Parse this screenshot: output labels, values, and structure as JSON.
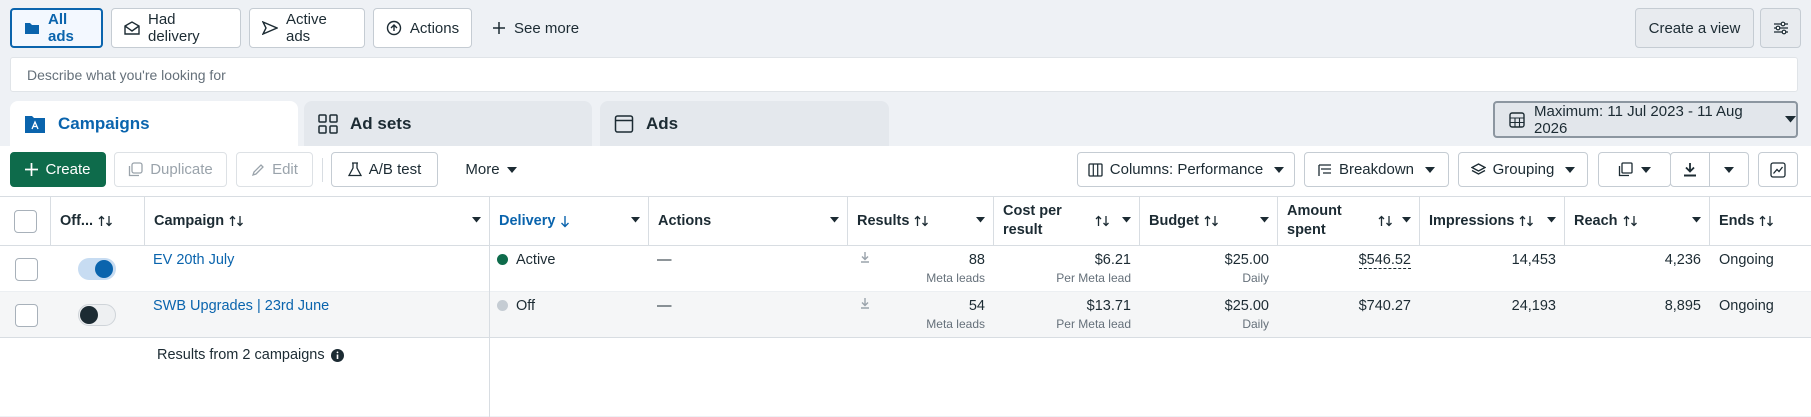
{
  "filters": {
    "all_ads": "All ads",
    "had_delivery": "Had delivery",
    "active_ads": "Active ads",
    "actions": "Actions",
    "see_more": "See more",
    "create_view": "Create a view"
  },
  "search": {
    "placeholder": "Describe what you're looking for"
  },
  "level_tabs": {
    "campaigns": "Campaigns",
    "ad_sets": "Ad sets",
    "ads": "Ads"
  },
  "date_range": "Maximum: 11 Jul 2023 - 11 Aug 2026",
  "toolbar": {
    "create": "Create",
    "duplicate": "Duplicate",
    "edit": "Edit",
    "ab_test": "A/B test",
    "more": "More",
    "columns": "Columns: Performance",
    "breakdown": "Breakdown",
    "grouping": "Grouping"
  },
  "columns": {
    "off_on": "Off...",
    "campaign": "Campaign",
    "delivery": "Delivery",
    "actions": "Actions",
    "results": "Results",
    "cost_per_result": [
      "Cost per",
      "result"
    ],
    "budget": "Budget",
    "amount_spent": [
      "Amount",
      "spent"
    ],
    "impressions": "Impressions",
    "reach": "Reach",
    "ends": "Ends"
  },
  "rows": [
    {
      "toggle_on": true,
      "campaign": "EV 20th July",
      "delivery": "Active",
      "actions": "—",
      "results": "88",
      "results_sub": "Meta leads",
      "cost": "$6.21",
      "cost_sub": "Per Meta lead",
      "budget": "$25.00",
      "budget_sub": "Daily",
      "spent": "$546.52",
      "impressions": "14,453",
      "reach": "4,236",
      "ends": "Ongoing"
    },
    {
      "toggle_on": false,
      "campaign": "SWB Upgrades | 23rd June",
      "delivery": "Off",
      "actions": "—",
      "results": "54",
      "results_sub": "Meta leads",
      "cost": "$13.71",
      "cost_sub": "Per Meta lead",
      "budget": "$25.00",
      "budget_sub": "Daily",
      "spent": "$740.27",
      "impressions": "24,193",
      "reach": "8,895",
      "ends": "Ongoing"
    }
  ],
  "summary": "Results from 2 campaigns",
  "colors": {
    "accent": "#0a64ad",
    "primary_button": "#0e6b4b",
    "active_dot": "#0e6b4b",
    "off_dot": "#c5ccd3"
  }
}
